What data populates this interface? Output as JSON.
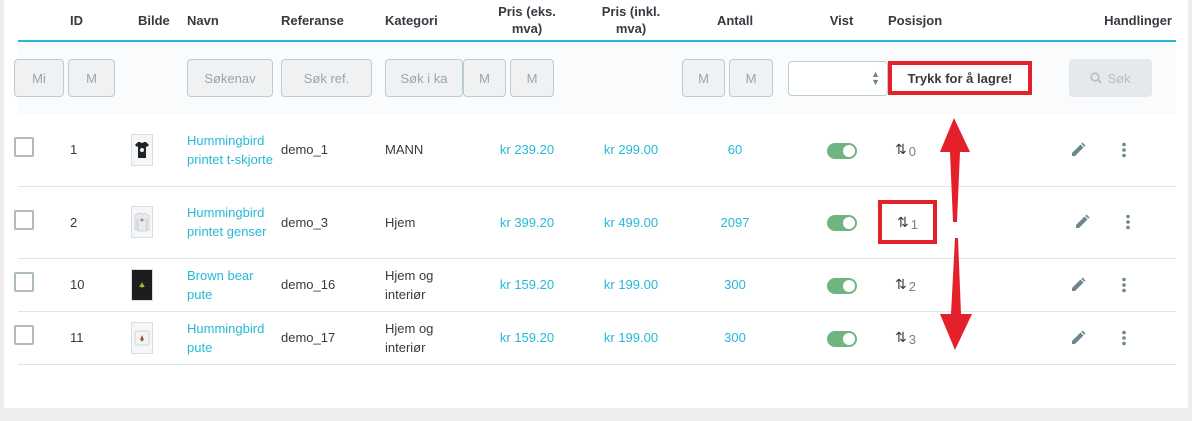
{
  "headers": {
    "id": "ID",
    "image": "Bilde",
    "name": "Navn",
    "reference": "Referanse",
    "category": "Kategori",
    "price_excl": "Pris (eks. mva)",
    "price_incl": "Pris (inkl. mva)",
    "quantity": "Antall",
    "shown": "Vist",
    "position": "Posisjon",
    "actions": "Handlinger"
  },
  "filters": {
    "id_min_placeholder": "Mi",
    "id_max_placeholder": "M",
    "name_placeholder": "Søkenav",
    "reference_placeholder": "Søk ref.",
    "category_placeholder": "Søk i ka",
    "price_excl_min_placeholder": "M",
    "price_excl_max_placeholder": "M",
    "quantity_min_placeholder": "M",
    "quantity_max_placeholder": "M",
    "shown_select_value": "",
    "save_hint": "Trykk for å lagre!",
    "search_label": "Søk"
  },
  "rows": [
    {
      "id": "1",
      "name": "Hummingbird printet t-skjorte",
      "reference": "demo_1",
      "category": "MANN",
      "price_excl": "kr 239.20",
      "price_incl": "kr 299.00",
      "quantity": "60",
      "position": "0",
      "image_icon": "tshirt-icon"
    },
    {
      "id": "2",
      "name": "Hummingbird printet genser",
      "reference": "demo_3",
      "category": "Hjem",
      "price_excl": "kr 399.20",
      "price_incl": "kr 499.00",
      "quantity": "2097",
      "position": "1",
      "image_icon": "sweater-icon"
    },
    {
      "id": "10",
      "name": "Brown bear pute",
      "reference": "demo_16",
      "category": "Hjem og interiør",
      "price_excl": "kr 159.20",
      "price_incl": "kr 199.00",
      "quantity": "300",
      "position": "2",
      "image_icon": "black-cushion-icon"
    },
    {
      "id": "11",
      "name": "Hummingbird pute",
      "reference": "demo_17",
      "category": "Hjem og interiør",
      "price_excl": "kr 159.20",
      "price_incl": "kr 199.00",
      "quantity": "300",
      "position": "3",
      "image_icon": "white-cushion-icon"
    }
  ],
  "colors": {
    "accent": "#25b9d7",
    "toggle_on": "#70b580",
    "annotation_red": "#e4202a"
  }
}
